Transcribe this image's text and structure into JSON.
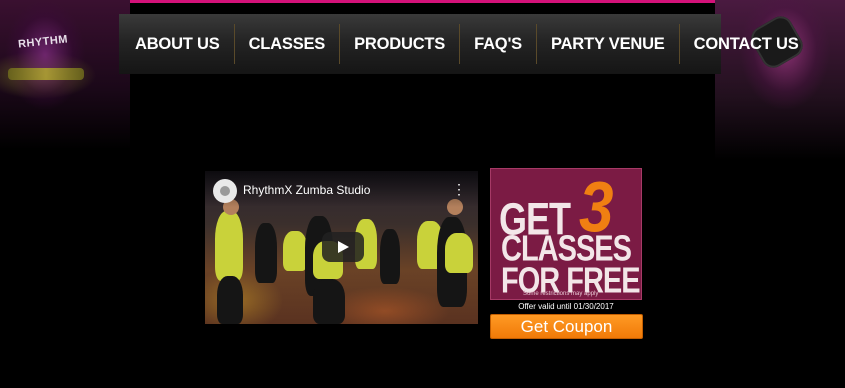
{
  "nav": {
    "items": [
      {
        "label": "ABOUT US"
      },
      {
        "label": "CLASSES"
      },
      {
        "label": "PRODUCTS"
      },
      {
        "label": "FAQ'S"
      },
      {
        "label": "PARTY VENUE"
      },
      {
        "label": "CONTACT US"
      }
    ]
  },
  "hero": {
    "shirt_text": "RHYTHM"
  },
  "video": {
    "title": "RhythmX Zumba Studio",
    "menu_icon": "more-vert-icon"
  },
  "promo": {
    "get": "GET",
    "number": "3",
    "classes": "CLASSES",
    "free": "FOR FREE",
    "restrictions": "Some restrictions may apply",
    "offer_valid": "Offer valid until 01/30/2017",
    "coupon_label": "Get Coupon"
  },
  "colors": {
    "accent": "#d4127a",
    "promo_bg": "#7b1b44",
    "promo_number": "#f07f12",
    "coupon": "#f07a08"
  }
}
